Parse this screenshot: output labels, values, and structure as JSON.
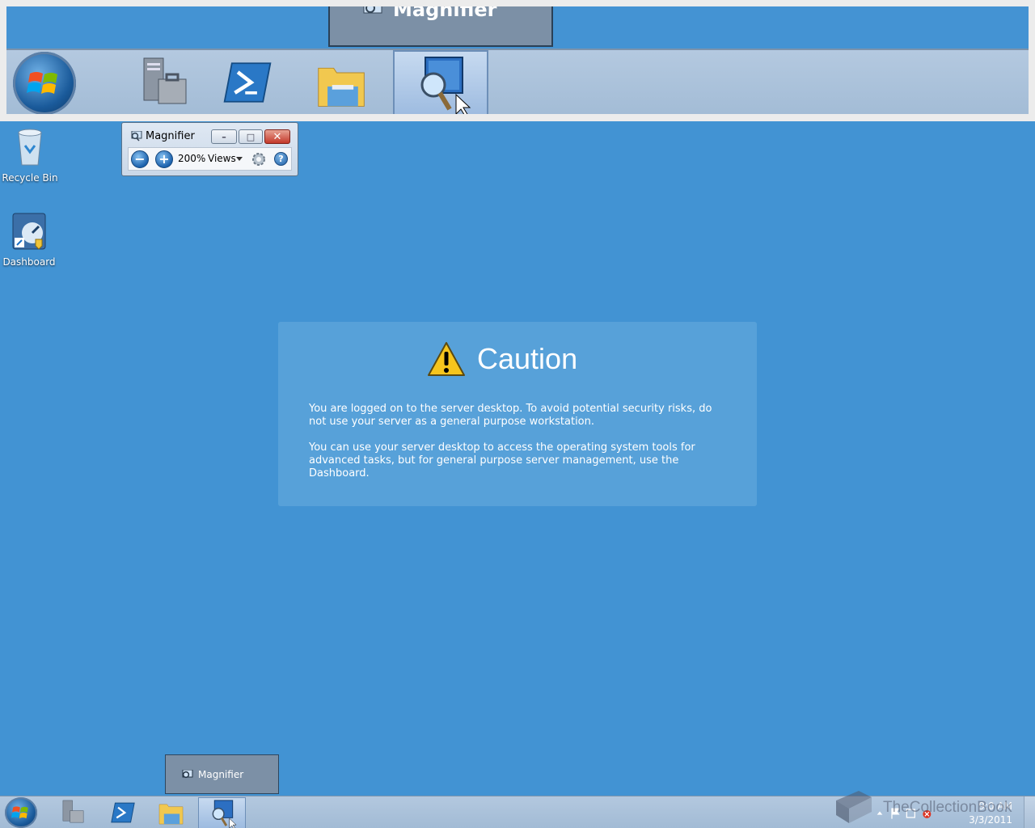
{
  "lens": {
    "thumbnail_label": "Magnifier"
  },
  "desktop": {
    "icons": [
      {
        "label": "Recycle Bin"
      },
      {
        "label": "Dashboard"
      }
    ]
  },
  "magnifier_window": {
    "title": "Magnifier",
    "zoom": "200%",
    "views_label": "Views",
    "zoom_out_symbol": "−",
    "zoom_in_symbol": "+",
    "help_symbol": "?"
  },
  "caution": {
    "title": "Caution",
    "paragraph1": "You are logged on to the server desktop. To avoid potential security risks, do not use your server as a general purpose workstation.",
    "paragraph2": "You can use your server desktop to access the operating system tools for advanced tasks, but for general purpose server management, use the Dashboard."
  },
  "taskbar": {
    "thumbnail_popup_label": "Magnifier",
    "pinned": [
      "start-button",
      "server-manager-icon",
      "powershell-icon",
      "explorer-icon",
      "magnifier-icon"
    ],
    "clock_time": "9:0 AM",
    "clock_date": "3/3/2011"
  },
  "watermark": "TheCollectionBook",
  "colors": {
    "desktop": "#4293d3",
    "taskbar": "#a9c0d9",
    "caution_panel": "#57a1d9"
  }
}
